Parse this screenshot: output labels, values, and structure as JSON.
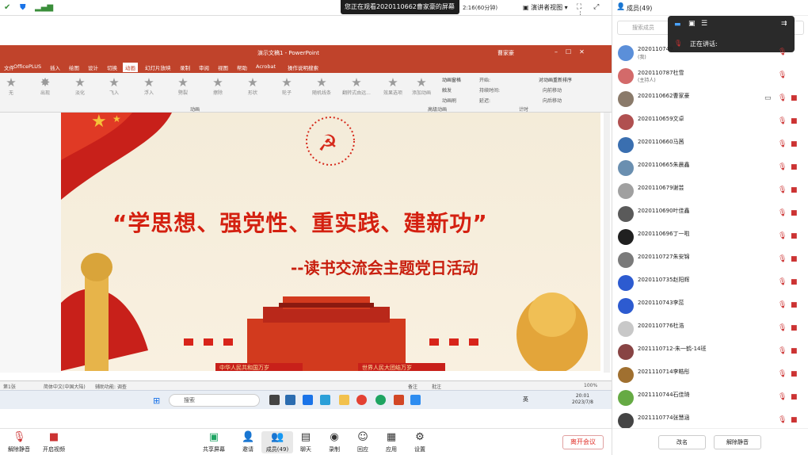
{
  "topbar": {
    "share_banner": "您正在观看2020110662曹家豪的屏幕",
    "timer": "2:16(60分钟)",
    "view_mode": "演讲者视图"
  },
  "ppt": {
    "window_title": "演示文稿1 - PowerPoint",
    "user": "曹家豪",
    "tabs": [
      "文件",
      "OfficePLUS",
      "插入",
      "绘图",
      "设计",
      "切换",
      "动画",
      "幻灯片放映",
      "录制",
      "审阅",
      "视图",
      "帮助",
      "Acrobat",
      "操作说明搜索"
    ],
    "active_tab": "动画",
    "ribbon_effects": [
      "无",
      "出现",
      "淡化",
      "飞入",
      "浮入",
      "劈裂",
      "擦除",
      "形状",
      "轮子",
      "随机线条",
      "翻转式由远...",
      "效果选项",
      "添加动画"
    ],
    "ribbon_mid": [
      "动画窗格",
      "触发",
      "动画刷"
    ],
    "ribbon_timing": [
      "开始:",
      "持续时间:",
      "延迟:",
      "对动画重新排序",
      "向前移动",
      "向后移动"
    ],
    "ribbon_groups": [
      "动画",
      "高级动画",
      "计时"
    ],
    "status": {
      "slide": "第1张",
      "lang": "简体中文(中国大陆)",
      "accessibility": "辅助功能: 调查",
      "notes": "备注",
      "comments": "批注",
      "zoom": "100%"
    }
  },
  "slide": {
    "title": "“学思想、强党性、重实践、建新功”",
    "subtitle": "--读书交流会主题党日活动",
    "banner_left": "中华人民共和国万岁",
    "banner_right": "世界人民大团结万岁"
  },
  "taskbar": {
    "search": "搜索",
    "time": "20:01",
    "date": "2023/7/8",
    "ime": "英"
  },
  "meeting_bar": {
    "unmute": "解除静音",
    "video": "开启视频",
    "share": "共享屏幕",
    "invite": "邀请",
    "members": "成员(49)",
    "chat": "聊天",
    "record": "录制",
    "reactions": "回应",
    "apps": "应用",
    "settings": "设置",
    "leave": "离开会议"
  },
  "panel": {
    "title": "成员(49)",
    "search_placeholder": "搜索成员",
    "speaking": "正在讲话:",
    "members": [
      {
        "name": "2020110749...",
        "sub": "(我)"
      },
      {
        "name": "2020110787杜雪",
        "sub": "(主持人)"
      },
      {
        "name": "2020110662曹家豪",
        "sub": ""
      },
      {
        "name": "2020110659文卓",
        "sub": ""
      },
      {
        "name": "2020110660马茜",
        "sub": ""
      },
      {
        "name": "2020110665朱晨鑫",
        "sub": ""
      },
      {
        "name": "2020110679谢芸",
        "sub": ""
      },
      {
        "name": "2020110690叶佳鑫",
        "sub": ""
      },
      {
        "name": "2020110696丁一啦",
        "sub": ""
      },
      {
        "name": "2020110727朱安锦",
        "sub": ""
      },
      {
        "name": "2020110735赵阳辉",
        "sub": ""
      },
      {
        "name": "2020110743李蕊",
        "sub": ""
      },
      {
        "name": "2020110776杜浩",
        "sub": ""
      },
      {
        "name": "2021110712-朱一鹤-14班",
        "sub": ""
      },
      {
        "name": "2021110714李皓彤",
        "sub": ""
      },
      {
        "name": "2021110744石佳琦",
        "sub": ""
      },
      {
        "name": "2021110774张慧涵",
        "sub": ""
      }
    ],
    "mute_all": "改名",
    "unmute_all": "解除静音"
  },
  "colors": {
    "ppt_red": "#c0432b",
    "slide_red": "#d42010",
    "accent": "#1a73e8"
  }
}
